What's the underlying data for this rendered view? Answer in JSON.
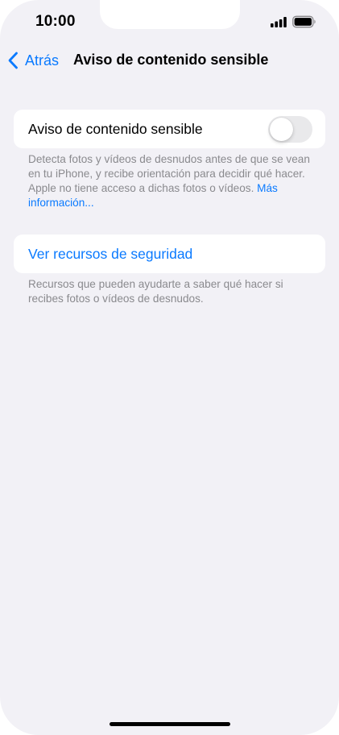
{
  "status_bar": {
    "time": "10:00"
  },
  "nav": {
    "back_label": "Atrás",
    "title": "Aviso de contenido sensible"
  },
  "settings": {
    "toggle_row": {
      "label": "Aviso de contenido sensible",
      "enabled": false
    },
    "toggle_footer": "Detecta fotos y vídeos de desnudos antes de que se vean en tu iPhone, y recibe orientación para decidir qué hacer. Apple no tiene acceso a dichas fotos o vídeos.",
    "toggle_footer_link": "Más información...",
    "resources_row": {
      "label": "Ver recursos de seguridad"
    },
    "resources_footer": "Recursos que pueden ayudarte a saber qué hacer si recibes fotos o vídeos de desnudos."
  },
  "colors": {
    "accent": "#0a7aff",
    "background": "#f2f1f6",
    "footer_text": "#8a8a8e",
    "toggle_off": "#e9e9eb"
  }
}
